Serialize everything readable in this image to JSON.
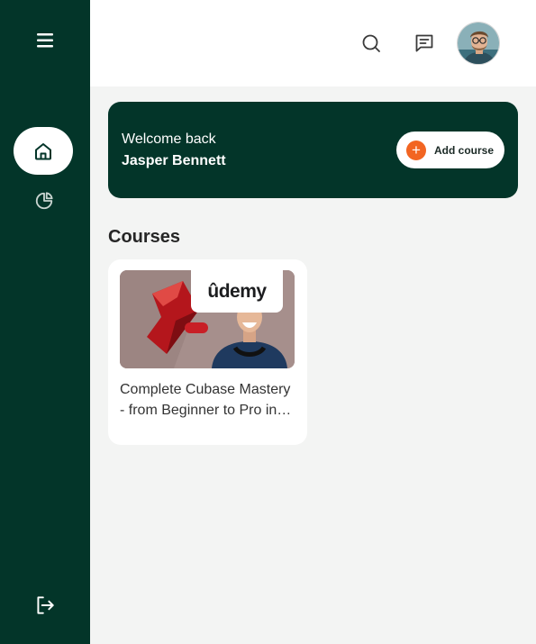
{
  "sidebar": {
    "menu_icon": "hamburger-icon",
    "items": [
      {
        "icon": "home-icon",
        "active": true
      },
      {
        "icon": "pie-chart-icon",
        "active": false
      }
    ],
    "logout_icon": "logout-icon"
  },
  "header": {
    "search_icon": "search-icon",
    "messages_icon": "message-icon",
    "avatar": "user-avatar"
  },
  "welcome": {
    "greeting": "Welcome back",
    "name": "Jasper Bennett",
    "add_button_label": "Add course"
  },
  "courses": {
    "title": "Courses",
    "items": [
      {
        "provider": "ûdemy",
        "title": "Complete Cubase Mastery - from Beginner to Pro in Music Production"
      }
    ]
  },
  "colors": {
    "sidebar": "#033529",
    "accent": "#f26522",
    "background": "#f3f4f3"
  }
}
